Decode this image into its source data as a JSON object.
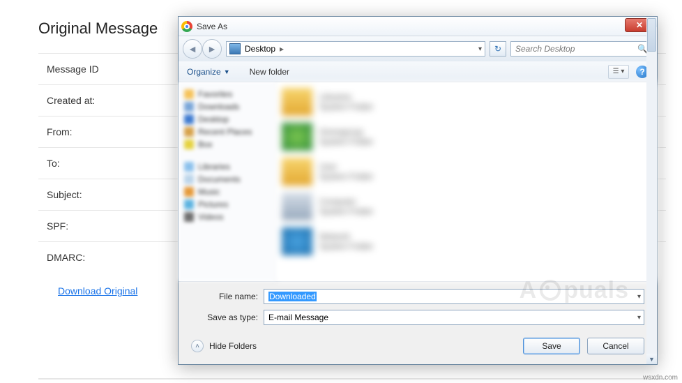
{
  "bg": {
    "title": "Original Message",
    "rows": [
      "Message ID",
      "Created at:",
      "From:",
      "To:",
      "Subject:",
      "SPF:",
      "DMARC:"
    ],
    "download": "Download Original"
  },
  "dialog": {
    "title": "Save As",
    "close_glyph": "✕",
    "back_glyph": "◄",
    "fwd_glyph": "►",
    "address": {
      "location": "Desktop",
      "sep": "▸",
      "drop": "▾"
    },
    "refresh_glyph": "↻",
    "search": {
      "placeholder": "Search Desktop",
      "mag": "🔍"
    },
    "toolbar": {
      "organize": "Organize",
      "drop": "▼",
      "newfolder": "New folder",
      "view_glyph": "☰ ▾",
      "help_glyph": "?"
    },
    "form": {
      "filename_label": "File name:",
      "filename_value": "Downloaded",
      "type_label": "Save as type:",
      "type_value": "E-mail Message"
    },
    "hide_folders": "Hide Folders",
    "hide_chev": "˄",
    "save": "Save",
    "cancel": "Cancel"
  },
  "watermark": {
    "left": "A",
    "right": "puals"
  },
  "credit": "wsxdn.com"
}
